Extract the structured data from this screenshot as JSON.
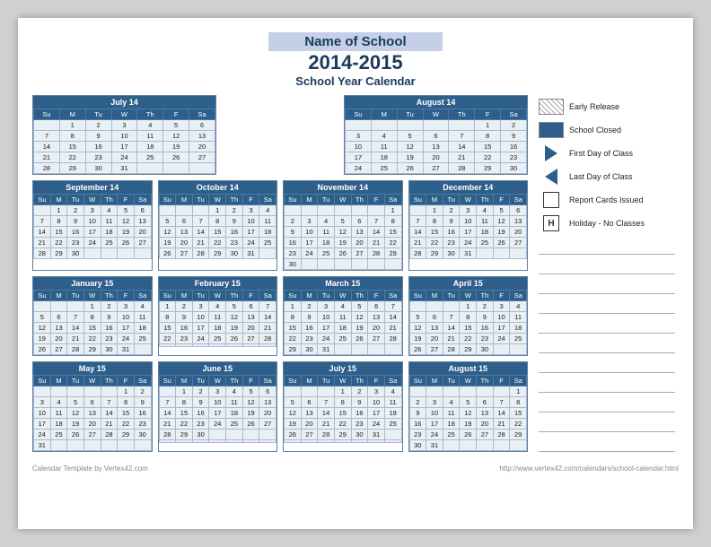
{
  "header": {
    "school_name": "Name of School",
    "year": "2014-2015",
    "subtitle": "School Year Calendar"
  },
  "legend": {
    "early_release": "Early Release",
    "school_closed": "School Closed",
    "first_day": "First Day of Class",
    "last_day": "Last Day of Class",
    "report_cards": "Report Cards Issued",
    "holiday": "Holiday - No Classes"
  },
  "footer": {
    "left": "Calendar Template by Vertex42.com",
    "right": "http://www.vertex42.com/calendars/school-calendar.html"
  },
  "months": [
    {
      "name": "July 14",
      "days": [
        "",
        "1",
        "2",
        "3",
        "4",
        "5",
        "6",
        "7",
        "8",
        "9",
        "10",
        "11",
        "12",
        "13",
        "14",
        "15",
        "16",
        "17",
        "18",
        "19",
        "20",
        "21",
        "22",
        "23",
        "24",
        "25",
        "26",
        "27",
        "28",
        "29",
        "30",
        "31"
      ]
    },
    {
      "name": "August 14",
      "days": [
        "",
        "",
        "",
        "",
        "",
        "1",
        "2",
        "3",
        "4",
        "5",
        "6",
        "7",
        "8",
        "9",
        "10",
        "11",
        "12",
        "13",
        "14",
        "15",
        "16",
        "17",
        "18",
        "19",
        "20",
        "21",
        "22",
        "23",
        "24",
        "25",
        "26",
        "27",
        "28",
        "29",
        "30"
      ]
    },
    {
      "name": "September 14",
      "days": [
        "",
        "1",
        "2",
        "3",
        "4",
        "5",
        "6",
        "7",
        "8",
        "9",
        "10",
        "11",
        "12",
        "13",
        "14",
        "15",
        "16",
        "17",
        "18",
        "19",
        "20",
        "21",
        "22",
        "23",
        "24",
        "25",
        "26",
        "27",
        "28",
        "29",
        "30"
      ]
    },
    {
      "name": "October 14",
      "days": [
        "",
        "",
        "",
        "1",
        "2",
        "3",
        "4",
        "5",
        "6",
        "7",
        "8",
        "9",
        "10",
        "11",
        "12",
        "13",
        "14",
        "15",
        "16",
        "17",
        "18",
        "19",
        "20",
        "21",
        "22",
        "23",
        "24",
        "25",
        "26",
        "27",
        "28",
        "29",
        "30",
        "31"
      ]
    },
    {
      "name": "November 14",
      "days": [
        "",
        "",
        "",
        "",
        "",
        "",
        "1",
        "2",
        "3",
        "4",
        "5",
        "6",
        "7",
        "8",
        "9",
        "10",
        "11",
        "12",
        "13",
        "14",
        "15",
        "16",
        "17",
        "18",
        "19",
        "20",
        "21",
        "22",
        "23",
        "24",
        "25",
        "26",
        "27",
        "28",
        "29",
        "30"
      ]
    },
    {
      "name": "December 14",
      "days": [
        "",
        "1",
        "2",
        "3",
        "4",
        "5",
        "6",
        "7",
        "8",
        "9",
        "10",
        "11",
        "12",
        "13",
        "14",
        "15",
        "16",
        "17",
        "18",
        "19",
        "20",
        "21",
        "22",
        "23",
        "24",
        "25",
        "26",
        "27",
        "28",
        "29",
        "30",
        "31"
      ]
    },
    {
      "name": "January 15",
      "days": [
        "",
        "",
        "",
        "1",
        "2",
        "3",
        "4",
        "5",
        "6",
        "7",
        "8",
        "9",
        "10",
        "11",
        "12",
        "13",
        "14",
        "15",
        "16",
        "17",
        "18",
        "19",
        "20",
        "21",
        "22",
        "23",
        "24",
        "25",
        "26",
        "27",
        "28",
        "29",
        "30",
        "31"
      ]
    },
    {
      "name": "February 15",
      "days": [
        "",
        "2",
        "3",
        "4",
        "5",
        "6",
        "7",
        "8",
        "9",
        "10",
        "11",
        "12",
        "13",
        "14",
        "15",
        "16",
        "17",
        "18",
        "19",
        "20",
        "21",
        "22",
        "23",
        "24",
        "25",
        "26",
        "27",
        "28"
      ]
    },
    {
      "name": "March 15",
      "days": [
        "",
        "2",
        "3",
        "4",
        "5",
        "6",
        "7",
        "8",
        "9",
        "10",
        "11",
        "12",
        "13",
        "14",
        "15",
        "16",
        "17",
        "18",
        "19",
        "20",
        "21",
        "22",
        "23",
        "24",
        "25",
        "26",
        "27",
        "28",
        "29",
        "30",
        "31"
      ]
    },
    {
      "name": "April 15",
      "days": [
        "",
        "",
        "",
        "1",
        "2",
        "3",
        "4",
        "5",
        "6",
        "7",
        "8",
        "9",
        "10",
        "11",
        "12",
        "13",
        "14",
        "15",
        "16",
        "17",
        "18",
        "19",
        "20",
        "21",
        "22",
        "23",
        "24",
        "25",
        "26",
        "27",
        "28",
        "29",
        "30"
      ]
    },
    {
      "name": "May 15",
      "days": [
        "",
        "",
        "",
        "",
        "",
        "1",
        "2",
        "3",
        "4",
        "5",
        "6",
        "7",
        "8",
        "9",
        "10",
        "11",
        "12",
        "13",
        "14",
        "15",
        "16",
        "17",
        "18",
        "19",
        "20",
        "21",
        "22",
        "23",
        "24",
        "25",
        "26",
        "27",
        "28",
        "29",
        "30",
        "31"
      ]
    },
    {
      "name": "June 15",
      "days": [
        "",
        "1",
        "2",
        "3",
        "4",
        "5",
        "6",
        "7",
        "8",
        "9",
        "10",
        "11",
        "12",
        "13",
        "14",
        "15",
        "16",
        "17",
        "18",
        "19",
        "20",
        "21",
        "22",
        "23",
        "24",
        "25",
        "26",
        "27",
        "28",
        "29",
        "30"
      ]
    },
    {
      "name": "July 15",
      "days": [
        "",
        "",
        "",
        "1",
        "2",
        "3",
        "4",
        "5",
        "6",
        "7",
        "8",
        "9",
        "10",
        "11",
        "12",
        "13",
        "14",
        "15",
        "16",
        "17",
        "18",
        "19",
        "20",
        "21",
        "22",
        "23",
        "24",
        "25",
        "26",
        "27",
        "28",
        "29",
        "30",
        "31"
      ]
    },
    {
      "name": "August 15",
      "days": [
        "",
        "",
        "",
        "",
        "",
        "",
        "1",
        "2",
        "3",
        "4",
        "5",
        "6",
        "7",
        "8",
        "9",
        "10",
        "11",
        "12",
        "13",
        "14",
        "15",
        "16",
        "17",
        "18",
        "19",
        "20",
        "21",
        "22",
        "23",
        "24",
        "25",
        "26",
        "27",
        "28",
        "29"
      ]
    }
  ]
}
